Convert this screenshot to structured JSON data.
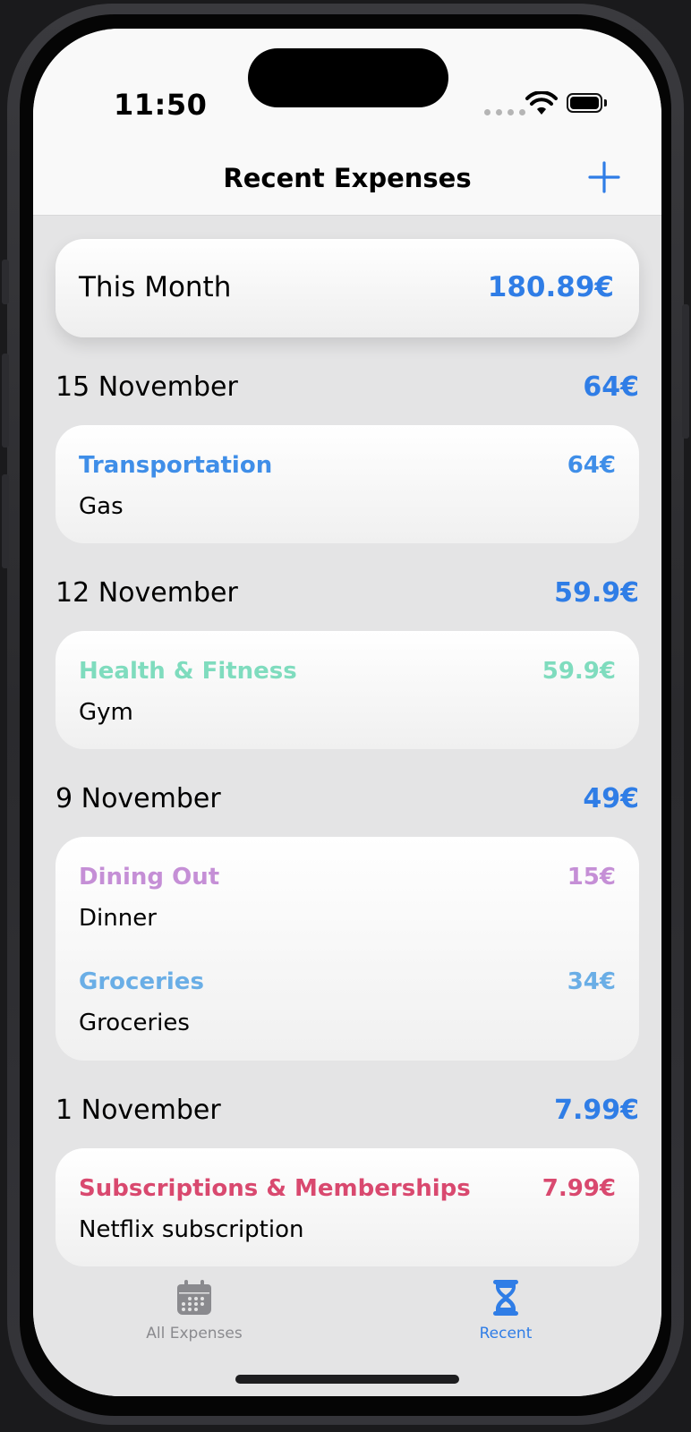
{
  "status_bar": {
    "time": "11:50"
  },
  "nav": {
    "title": "Recent Expenses",
    "add_icon": "plus-icon"
  },
  "summary": {
    "label": "This Month",
    "amount": "180.89€"
  },
  "colors": {
    "accent": "#2f7de6",
    "transportation": "#3f8ee8",
    "health_fitness": "#7fdcbe",
    "dining_out": "#c58fd6",
    "groceries": "#6aaee6",
    "subscriptions": "#d9496f",
    "tab_inactive": "#8a8a8e"
  },
  "days": [
    {
      "date": "15 November",
      "total": "64€",
      "expenses": [
        {
          "category": "Transportation",
          "amount": "64€",
          "description": "Gas"
        }
      ]
    },
    {
      "date": "12 November",
      "total": "59.9€",
      "expenses": [
        {
          "category": "Health & Fitness",
          "amount": "59.9€",
          "description": "Gym"
        }
      ]
    },
    {
      "date": "9 November",
      "total": "49€",
      "expenses": [
        {
          "category": "Dining Out",
          "amount": "15€",
          "description": "Dinner"
        },
        {
          "category": "Groceries",
          "amount": "34€",
          "description": "Groceries"
        }
      ]
    },
    {
      "date": "1 November",
      "total": "7.99€",
      "expenses": [
        {
          "category": "Subscriptions & Memberships",
          "amount": "7.99€",
          "description": "Netflix subscription"
        }
      ]
    }
  ],
  "tabs": [
    {
      "label": "All Expenses",
      "icon": "calendar-icon",
      "active": false
    },
    {
      "label": "Recent",
      "icon": "hourglass-icon",
      "active": true
    }
  ]
}
